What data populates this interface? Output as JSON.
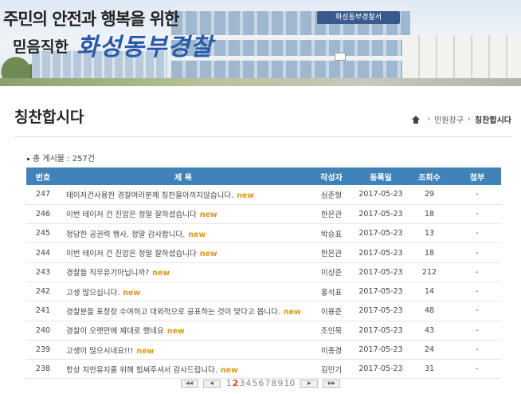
{
  "banner": {
    "slogan_line1": "주민의 안전과 행복을 위한",
    "slogan_line2": "믿음직한",
    "slogan_brand": "화성동부경찰",
    "building_sign": "화성동부경찰서"
  },
  "page": {
    "title": "칭찬합시다",
    "breadcrumb": {
      "level1": "민원창구",
      "current": "칭찬합시다"
    }
  },
  "board": {
    "total_label": "총 게시물 : 257건",
    "columns": [
      "번호",
      "제 목",
      "작성자",
      "등록일",
      "조회수",
      "첨부"
    ],
    "new_label": "new",
    "rows": [
      {
        "no": "247",
        "title": "테이저건사용한 경찰여러분께 칭찬을아끼지않습니다.",
        "author": "심준형",
        "date": "2017-05-23",
        "views": "29",
        "attach": "-"
      },
      {
        "no": "246",
        "title": "이번 테이저 건 진압은 정말 잘하셨습니다",
        "author": "한은관",
        "date": "2017-05-23",
        "views": "18",
        "attach": "-"
      },
      {
        "no": "245",
        "title": "정당한 공권력 행사. 정말 감사합니다.",
        "author": "박승표",
        "date": "2017-05-23",
        "views": "13",
        "attach": "-"
      },
      {
        "no": "244",
        "title": "이번 테이저 건 진압은 정말 잘하셨습니다",
        "author": "한은관",
        "date": "2017-05-23",
        "views": "18",
        "attach": "-"
      },
      {
        "no": "243",
        "title": "경찰들 직무유기아닙니까?",
        "author": "이상준",
        "date": "2017-05-23",
        "views": "212",
        "attach": "-"
      },
      {
        "no": "242",
        "title": "고생 많으십니다.",
        "author": "홍석표",
        "date": "2017-05-23",
        "views": "14",
        "attach": "-"
      },
      {
        "no": "241",
        "title": "경찰분들 표창장 수여하고 대외적으로 공표하는 것이 맞다고 봅니다.",
        "author": "이용준",
        "date": "2017-05-23",
        "views": "48",
        "attach": "-"
      },
      {
        "no": "240",
        "title": "경찰이 오랫만에 제대로 했네요",
        "author": "조인묵",
        "date": "2017-05-23",
        "views": "43",
        "attach": "-"
      },
      {
        "no": "239",
        "title": "고생이 많으시네요!!!",
        "author": "이종경",
        "date": "2017-05-23",
        "views": "24",
        "attach": "-"
      },
      {
        "no": "238",
        "title": "항상 치안유지를 위해 힘써주셔서 감사드립니다.",
        "author": "김민기",
        "date": "2017-05-23",
        "views": "31",
        "attach": "-"
      }
    ]
  },
  "pager": {
    "first_label": "◀◀",
    "prev_label": "◀",
    "next_label": "▶",
    "last_label": "▶▶",
    "pages": [
      "1",
      "2",
      "3",
      "4",
      "5",
      "6",
      "7",
      "8",
      "9",
      "10"
    ],
    "active_page": "2"
  },
  "colors": {
    "header_bg": "#3f83b8",
    "new_badge": "#d99a1a",
    "active_page": "#d8411e",
    "brand_blue": "#2a59a8"
  },
  "icons": {
    "home": "home-icon",
    "separator": "chevron-right-icon"
  }
}
